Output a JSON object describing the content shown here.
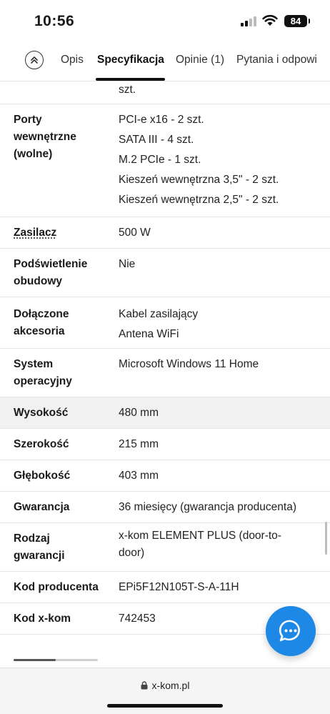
{
  "status_bar": {
    "time": "10:56",
    "battery": "84"
  },
  "tabs": [
    {
      "label": "Opis",
      "active": false
    },
    {
      "label": "Specyfikacja",
      "active": true
    },
    {
      "label": "Opinie (1)",
      "active": false
    },
    {
      "label": "Pytania i odpowi",
      "active": false
    }
  ],
  "spec_rows": [
    {
      "label": [],
      "values": [
        "szt."
      ]
    },
    {
      "label": [
        "Porty",
        "wewnętrzne",
        "(wolne)"
      ],
      "values": [
        "PCI-e x16 - 2 szt.",
        "SATA III - 4 szt.",
        "M.2 PCIe - 1 szt.",
        "Kieszeń wewnętrzna 3,5\" - 2 szt.",
        "Kieszeń wewnętrzna 2,5\" - 2 szt."
      ]
    },
    {
      "label": [
        "Zasilacz"
      ],
      "values": [
        "500 W"
      ]
    },
    {
      "label": [
        "Podświetlenie",
        "obudowy"
      ],
      "values": [
        "Nie"
      ]
    },
    {
      "label": [
        "Dołączone",
        "akcesoria"
      ],
      "values": [
        "Kabel zasilający",
        "Antena WiFi"
      ]
    },
    {
      "label": [
        "System",
        "operacyjny"
      ],
      "values": [
        "Microsoft Windows 11 Home"
      ]
    },
    {
      "label": [
        "Wysokość"
      ],
      "values": [
        "480 mm"
      ]
    },
    {
      "label": [
        "Szerokość"
      ],
      "values": [
        "215 mm"
      ]
    },
    {
      "label": [
        "Głębokość"
      ],
      "values": [
        "403 mm"
      ]
    },
    {
      "label": [
        "Gwarancja"
      ],
      "values": [
        "36 miesięcy (gwarancja producenta)"
      ]
    },
    {
      "label": [
        "Rodzaj",
        "gwarancji"
      ],
      "values": [
        "x-kom ELEMENT PLUS (door-to-",
        "door)"
      ]
    },
    {
      "label": [
        "Kod producenta"
      ],
      "values": [
        "EPi5F12N105T-S-A-11H"
      ]
    },
    {
      "label": [
        "Kod x-kom"
      ],
      "values": [
        "742453"
      ]
    }
  ],
  "browser": {
    "url": "x-kom.pl"
  },
  "colors": {
    "fab": "#1d88e5",
    "shaded_row": "#f1f1f1"
  }
}
